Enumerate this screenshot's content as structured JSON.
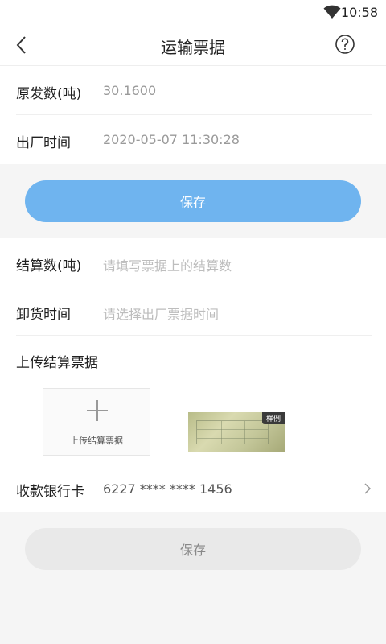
{
  "status_bar": {
    "time": "10:58",
    "wifi_icon": "wifi-icon"
  },
  "header": {
    "title": "运输票据",
    "back_icon": "back-arrow-icon",
    "help_icon": "question-icon"
  },
  "dispatch": {
    "weight_label": "原发数(吨)",
    "weight_value": "30.1600",
    "time_label": "出厂时间",
    "time_value": "2020-05-07 11:30:28",
    "save_label": "保存"
  },
  "settlement": {
    "weight_label": "结算数(吨)",
    "weight_placeholder": "请填写票据上的结算数",
    "unload_label": "卸货时间",
    "unload_placeholder": "请选择出厂票据时间",
    "upload_section_label": "上传结算票据",
    "upload_button_text": "上传结算票据",
    "sample_tag": "样例",
    "bank_label": "收款银行卡",
    "bank_value": "6227 **** **** 1456",
    "save_label": "保存"
  },
  "colors": {
    "primary_button": "#6fb4ef",
    "disabled_button": "#e9e9e9",
    "background": "#f5f5f5"
  }
}
